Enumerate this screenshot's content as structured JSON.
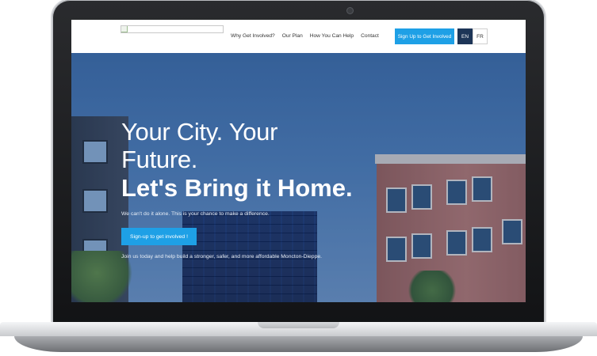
{
  "header": {
    "nav": [
      {
        "label": "Why Get Involved?"
      },
      {
        "label": "Our Plan"
      },
      {
        "label": "How You Can Help"
      },
      {
        "label": "Contact"
      }
    ],
    "cta_label": "Sign Up to Get Involved",
    "lang": {
      "en": "EN",
      "fr": "FR",
      "active": "EN"
    }
  },
  "hero": {
    "line1": "Your City. Your",
    "line2": "Future.",
    "line3": "Let's Bring it Home.",
    "subtitle": "We can't do it alone.  This is your chance to make a difference.",
    "button_label": "Sign-up to get involved !",
    "footer_text": "Join us today and help build a stronger, safer, and more affordable Moncton-Dieppe."
  },
  "colors": {
    "accent": "#1ea0e6",
    "lang_active_bg": "#1d3557",
    "hero_bg": "#3a6aa5"
  }
}
